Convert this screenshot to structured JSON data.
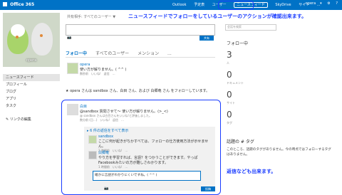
{
  "topbar": {
    "brand": "Office 365",
    "nav": [
      "Outlook",
      "予定表",
      "ユーザー",
      "ニュースフィード",
      "SkyDrive",
      "サイト",
      "..."
    ],
    "active_nav": "ニュースフィード",
    "user": "opera",
    "settings_icon": "gear-icon",
    "help_icon": "question-icon"
  },
  "annotations": {
    "top": "ニュースフィードでフォローをしているユーザーのアクションが確認出来ます。",
    "bottom": "返信なども出来ます。"
  },
  "profile": {
    "name": "opera",
    "nav": [
      "ニュースフィード",
      "プロフィール",
      "ブログ",
      "アプリ",
      "タスク"
    ],
    "active": "ニュースフィード",
    "edit_links": "リンクの編集"
  },
  "composer": {
    "placeholder": "共有相手: すべてのユーザー ▼",
    "share_button": "共有",
    "camera_icon": "camera-icon"
  },
  "tabs": [
    "フォロー中",
    "すべてのユーザー",
    "メンション",
    "..."
  ],
  "active_tab": "フォロー中",
  "posts": [
    {
      "author": "opera",
      "text": "使い方が解りません。( ^^ )",
      "meta": "数秒前　いいね!　返信　…"
    },
    {
      "author": "白目",
      "text": "@sandbox 質問させて～ 使い方が解りません。(>_<)",
      "meta": "@ sandbox さんは白目さんをいいね!と評価しました。",
      "meta2": "数分前 (日…)　いいね!　返信　…"
    }
  ],
  "follow_note": "★ opera さんは sandbox さん、白目 さん、および 白郷竜 さん をフォローしています。",
  "replies_header": "▸ 6 件の返信をすべて表示",
  "replies": [
    {
      "author": "sandbox",
      "text": "ここに何が起きがちかすべては、フォローの仕方使用方法が示せません。",
      "meta": "2 時間前　いいね!　…"
    },
    {
      "author": "白郷竜",
      "text": "やり方を学習すれば、言語？をつかうことができます。やっぱFacebookみたいの方が難しさわかります。",
      "meta": "1 時間前　いいね!　…"
    }
  ],
  "reply_input": "確かに言語がわかりにくいですね。( ^^ )",
  "reply_button": "投稿",
  "right": {
    "search_placeholder": "会話を検索",
    "title": "フォロー中",
    "stats": [
      {
        "num": "3",
        "label": "人"
      },
      {
        "num": "0",
        "label": "ドキュメント"
      },
      {
        "num": "0",
        "label": "サイト"
      },
      {
        "num": "0",
        "label": "タグ"
      }
    ],
    "tag_title": "話題の # タグ",
    "tag_desc": "このところ、話題のタグがありません。今の時点ではフォローするタグはありません。"
  }
}
